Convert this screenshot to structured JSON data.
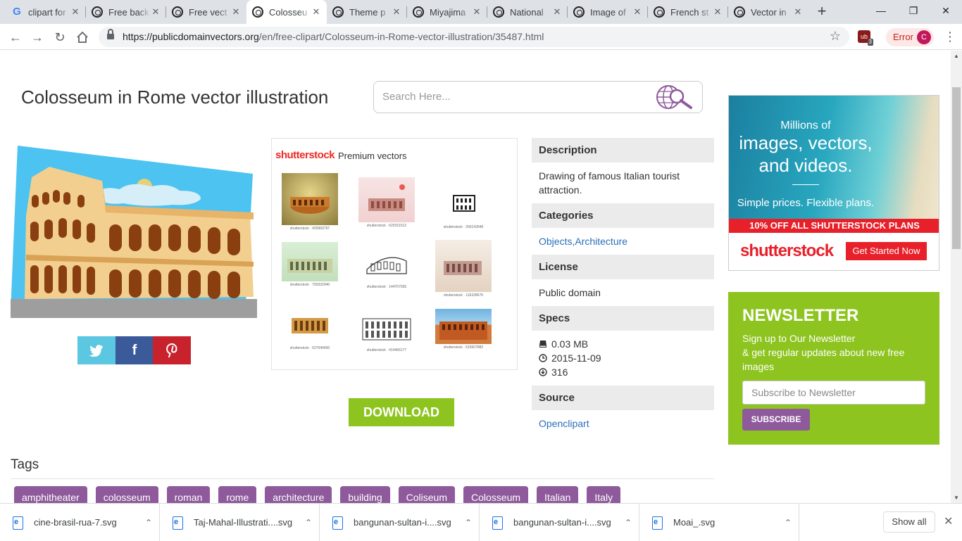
{
  "browser": {
    "tabs": [
      {
        "label": "clipart for",
        "icon": "google-icon"
      },
      {
        "label": "Free back",
        "icon": "site-favicon"
      },
      {
        "label": "Free vect",
        "icon": "site-favicon"
      },
      {
        "label": "Colosseu",
        "icon": "site-favicon",
        "active": true
      },
      {
        "label": "Theme p",
        "icon": "site-favicon"
      },
      {
        "label": "Miyajima",
        "icon": "site-favicon"
      },
      {
        "label": "National",
        "icon": "site-favicon"
      },
      {
        "label": "Image of",
        "icon": "site-favicon"
      },
      {
        "label": "French st",
        "icon": "site-favicon"
      },
      {
        "label": "Vector in",
        "icon": "site-favicon"
      }
    ],
    "url_host": "https://publicdomainvectors.org",
    "url_path": "/en/free-clipart/Colosseum-in-Rome-vector-illustration/35487.html",
    "extension_badge": "3",
    "profile_status": "Error",
    "profile_initial": "C"
  },
  "page": {
    "title": "Colosseum in Rome vector illustration",
    "search_placeholder": "Search Here...",
    "shutterstock_logo": "shutterstock",
    "premium_label": "Premium vectors",
    "thumb_captions": [
      "shutterstock · 425960797",
      "shutterstock · 620151512",
      "shutterstock · 266142648",
      "shutterstock · 793332940",
      "shutterstock · 144707935",
      "shutterstock · 116328676",
      "shutterstock · 627046600",
      "shutterstock · 414466177",
      "shutterstock · 615607882"
    ],
    "download_label": "DOWNLOAD",
    "share": {
      "twitter": "t",
      "facebook": "f",
      "pinterest": "p"
    },
    "info": {
      "description_head": "Description",
      "description": "Drawing of famous Italian tourist attraction.",
      "categories_head": "Categories",
      "categories": "Objects,Architecture",
      "license_head": "License",
      "license": "Public domain",
      "specs_head": "Specs",
      "size": "0.03 MB",
      "date": "2015-11-09",
      "downloads": "316",
      "source_head": "Source",
      "source": "Openclipart"
    },
    "ad": {
      "line1": "Millions of",
      "line2": "images, vectors,",
      "line3": "and videos.",
      "line4": "Simple prices. Flexible plans.",
      "bar": "10% OFF ALL SHUTTERSTOCK PLANS",
      "logo": "shutterstock",
      "cta": "Get Started Now"
    },
    "newsletter": {
      "title": "NEWSLETTER",
      "text1": "Sign up to Our Newsletter",
      "text2": "& get regular updates about new free images",
      "placeholder": "Subscribe to Newsletter",
      "button": "SUBSCRIBE"
    },
    "tags_heading": "Tags",
    "tags": [
      "amphitheater",
      "colosseum",
      "roman",
      "rome",
      "architecture",
      "building",
      "Coliseum",
      "Colosseum",
      "Italian",
      "Italy"
    ]
  },
  "downloads": {
    "items": [
      "cine-brasil-rua-7.svg",
      "Taj-Mahal-Illustrati....svg",
      "bangunan-sultan-i....svg",
      "bangunan-sultan-i....svg",
      "Moai_.svg"
    ],
    "show_all": "Show all"
  },
  "colors": {
    "green": "#8dc41f",
    "purple": "#8e5a9b",
    "shutter_red": "#e8202a",
    "twitter": "#5bc7e0",
    "facebook": "#3b5a9a",
    "pinterest": "#c8232c"
  }
}
